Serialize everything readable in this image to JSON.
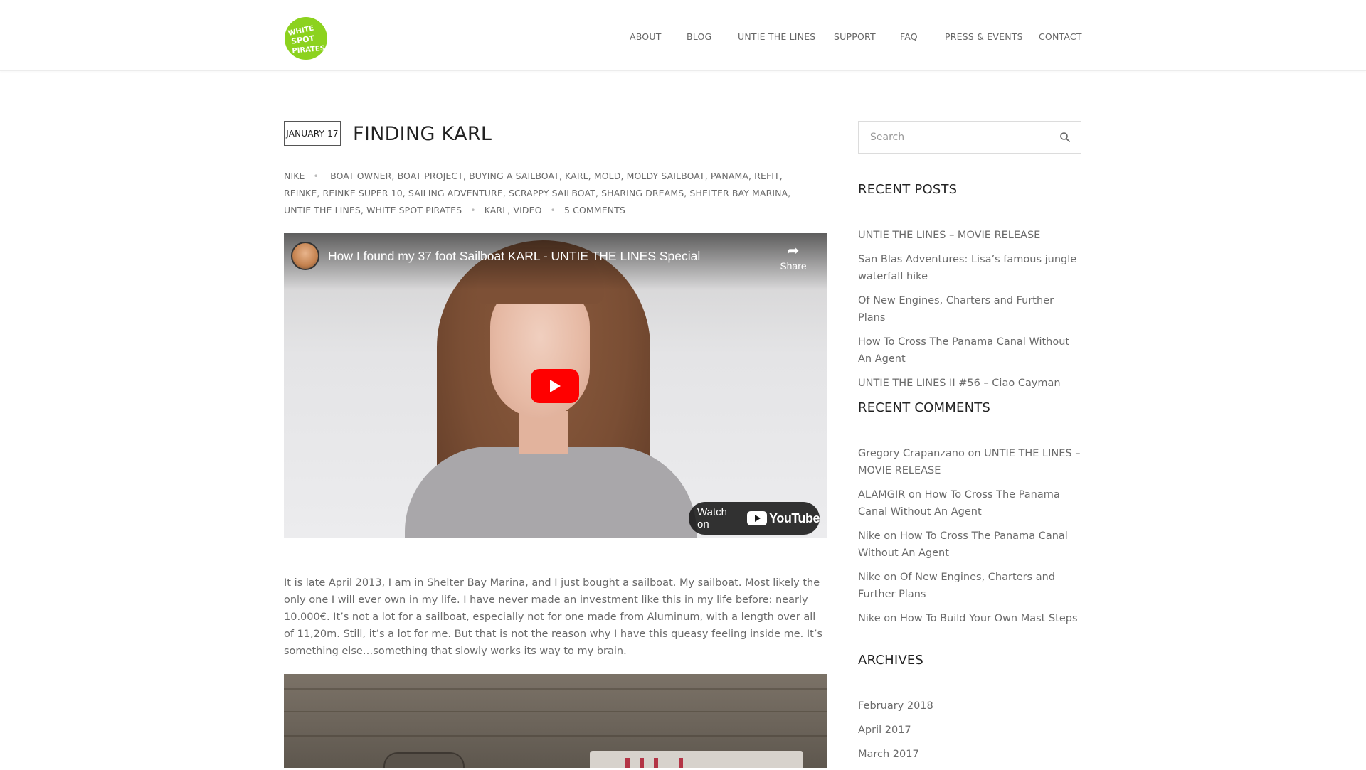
{
  "header": {
    "logo_text": "WHITE SPOT PIRATES",
    "nav": [
      "ABOUT",
      "BLOG",
      "UNTIE THE LINES",
      "SUPPORT",
      "FAQ",
      "PRESS & EVENTS",
      "CONTACT"
    ]
  },
  "post": {
    "date": "JANUARY 17",
    "title": "FINDING KARL",
    "author": "NIKE",
    "tags": [
      "BOAT OWNER",
      "BOAT PROJECT",
      "BUYING A SAILBOAT",
      "KARL",
      "MOLD",
      "MOLDY SAILBOAT",
      "PANAMA",
      "REFIT",
      "REINKE",
      "REINKE SUPER 10",
      "SAILING ADVENTURE",
      "SCRAPPY SAILBOAT",
      "SHARING DREAMS",
      "SHELTER BAY MARINA",
      "UNTIE THE LINES",
      "WHITE SPOT PIRATES"
    ],
    "categories": [
      "KARL",
      "VIDEO"
    ],
    "comments": "5 COMMENTS",
    "video": {
      "title": "How I found my 37 foot Sailboat KARL - UNTIE THE LINES Special",
      "share_label": "Share",
      "watch_on": "Watch on",
      "youtube_label": "YouTube"
    },
    "body": "It is late April 2013, I am in Shelter Bay Marina, and I just bought a sailboat. My sailboat. Most likely the only one I will ever own in my life. I have never made an investment like this in my life before: nearly 10.000€. It’s not a lot for a sailboat, especially not for one made from Aluminum, with a length over all of 11,20m. Still, it’s a lot for me. But that is not the reason why I have this queasy feeling inside me. It’s something else…something that slowly works its way to my brain."
  },
  "sidebar": {
    "search_placeholder": "Search",
    "recent_posts_title": "RECENT POSTS",
    "recent_posts": [
      "UNTIE THE LINES – MOVIE RELEASE",
      "San Blas Adventures: Lisa’s famous jungle waterfall hike",
      "Of New Engines, Charters and Further Plans",
      "How To Cross The Panama Canal Without An Agent",
      "UNTIE THE LINES II #56 – Ciao Cayman"
    ],
    "recent_comments_title": "RECENT COMMENTS",
    "recent_comments": [
      {
        "author": "Gregory Crapanzano",
        "on": "on",
        "post": "UNTIE THE LINES – MOVIE RELEASE"
      },
      {
        "author": "ALAMGIR",
        "on": "on",
        "post": "How To Cross The Panama Canal Without An Agent"
      },
      {
        "author": "Nike",
        "on": "on",
        "post": "How To Cross The Panama Canal Without An Agent"
      },
      {
        "author": "Nike",
        "on": "on",
        "post": "Of New Engines, Charters and Further Plans"
      },
      {
        "author": "Nike",
        "on": "on",
        "post": "How To Build Your Own Mast Steps"
      }
    ],
    "archives_title": "ARCHIVES",
    "archives": [
      "February 2018",
      "April 2017",
      "March 2017"
    ]
  },
  "colors": {
    "logo_green": "#8cd21e",
    "youtube_red": "#ff0000",
    "text": "#6a6a6a",
    "heading": "#222222"
  }
}
